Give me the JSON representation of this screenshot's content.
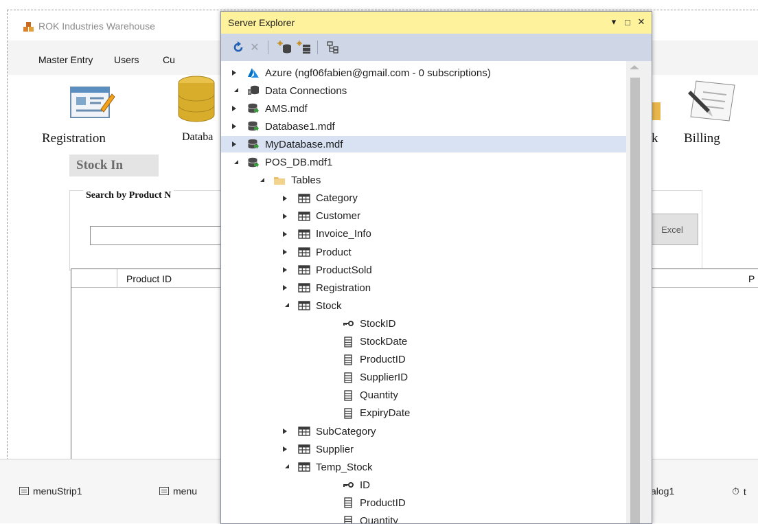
{
  "app": {
    "title": "ROK Industries Warehouse",
    "menu": [
      "Master Entry",
      "Users",
      "Cu"
    ],
    "tools": {
      "registration": "Registration",
      "database": "Databa",
      "stock": "k",
      "billing": "Billing"
    },
    "stock_in_title": "Stock In",
    "search_group_label": "Search by Product N",
    "search_value": "",
    "excel_button": "Excel",
    "grid_columns": [
      "Product ID",
      "P"
    ]
  },
  "tray": {
    "items": [
      "menuStrip1",
      "menu",
      "alog1",
      "t"
    ]
  },
  "server_explorer": {
    "title": "Server Explorer",
    "window_buttons": {
      "dropdown": "▾",
      "maximize": "□",
      "close": "✕"
    },
    "tree": [
      {
        "label": "Azure (ngf06fabien@gmail.com - 0 subscriptions)",
        "icon": "azure-icon",
        "level": 0,
        "state": "closed"
      },
      {
        "label": "Data Connections",
        "icon": "data-connections-icon",
        "level": 0,
        "state": "open"
      },
      {
        "label": "AMS.mdf",
        "icon": "database-icon",
        "level": 1,
        "state": "closed"
      },
      {
        "label": "Database1.mdf",
        "icon": "database-icon",
        "level": 1,
        "state": "closed"
      },
      {
        "label": "MyDatabase.mdf",
        "icon": "database-icon",
        "level": 1,
        "state": "closed",
        "selected": true
      },
      {
        "label": "POS_DB.mdf1",
        "icon": "database-icon",
        "level": 1,
        "state": "open"
      },
      {
        "label": "Tables",
        "icon": "folder-icon",
        "level": 2,
        "state": "open"
      },
      {
        "label": "Category",
        "icon": "table-icon",
        "level": 3,
        "state": "closed"
      },
      {
        "label": "Customer",
        "icon": "table-icon",
        "level": 3,
        "state": "closed"
      },
      {
        "label": "Invoice_Info",
        "icon": "table-icon",
        "level": 3,
        "state": "closed"
      },
      {
        "label": "Product",
        "icon": "table-icon",
        "level": 3,
        "state": "closed"
      },
      {
        "label": "ProductSold",
        "icon": "table-icon",
        "level": 3,
        "state": "closed"
      },
      {
        "label": "Registration",
        "icon": "table-icon",
        "level": 3,
        "state": "closed"
      },
      {
        "label": "Stock",
        "icon": "table-icon",
        "level": 3,
        "state": "open"
      },
      {
        "label": "StockID",
        "icon": "key-icon",
        "level": 4,
        "state": "none"
      },
      {
        "label": "StockDate",
        "icon": "column-icon",
        "level": 4,
        "state": "none"
      },
      {
        "label": "ProductID",
        "icon": "column-icon",
        "level": 4,
        "state": "none"
      },
      {
        "label": "SupplierID",
        "icon": "column-icon",
        "level": 4,
        "state": "none"
      },
      {
        "label": "Quantity",
        "icon": "column-icon",
        "level": 4,
        "state": "none"
      },
      {
        "label": "ExpiryDate",
        "icon": "column-icon",
        "level": 4,
        "state": "none"
      },
      {
        "label": "SubCategory",
        "icon": "table-icon",
        "level": 3,
        "state": "closed"
      },
      {
        "label": "Supplier",
        "icon": "table-icon",
        "level": 3,
        "state": "closed"
      },
      {
        "label": "Temp_Stock",
        "icon": "table-icon",
        "level": 3,
        "state": "open"
      },
      {
        "label": "ID",
        "icon": "key-icon",
        "level": 4,
        "state": "none"
      },
      {
        "label": "ProductID",
        "icon": "column-icon",
        "level": 4,
        "state": "none"
      },
      {
        "label": "Quantity",
        "icon": "column-icon",
        "level": 4,
        "state": "none"
      }
    ]
  },
  "colors": {
    "title_bar": "#fff29d",
    "toolbar": "#cfd6e5",
    "selection": "#d8e2f3",
    "azure": "#0072c6",
    "db_green": "#3c9a3c"
  }
}
